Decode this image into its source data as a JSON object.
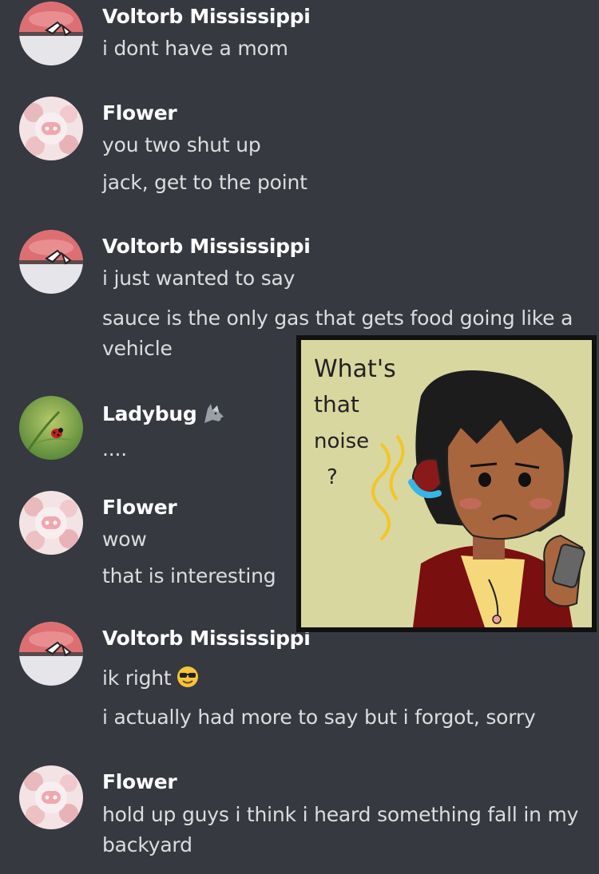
{
  "messages": [
    {
      "author": "Voltorb Mississippi",
      "lines": [
        "i dont have a mom"
      ]
    },
    {
      "author": "Flower",
      "lines": [
        "you two shut up",
        "jack, get to the point"
      ]
    },
    {
      "author": "Voltorb Mississippi",
      "lines": [
        "i just wanted to say",
        "sauce is the only gas that gets food going like a vehicle"
      ]
    },
    {
      "author": "Ladybug",
      "lines": [
        "...."
      ]
    },
    {
      "author": "Flower",
      "lines": [
        "wow",
        "that is interesting"
      ]
    },
    {
      "author": "Voltorb Mississippi",
      "lines": [
        "ik right",
        "i actually had more to say but i forgot, sorry"
      ]
    },
    {
      "author": "Flower",
      "lines": [
        "hold up guys i think i heard something fall in my backyard"
      ]
    }
  ],
  "comic": {
    "text_lines": [
      "What's",
      "that",
      "noise",
      "?"
    ]
  },
  "icons": {
    "voltorb": "voltorb-avatar-icon",
    "flower": "flower-avatar-icon",
    "ladybug": "ladybug-avatar-icon",
    "wolf": "wolf-emoji-icon",
    "sunglasses": "sunglasses-emoji-icon"
  },
  "colors": {
    "background": "#36393f",
    "author": "#ffffff",
    "text": "#dcddde"
  }
}
